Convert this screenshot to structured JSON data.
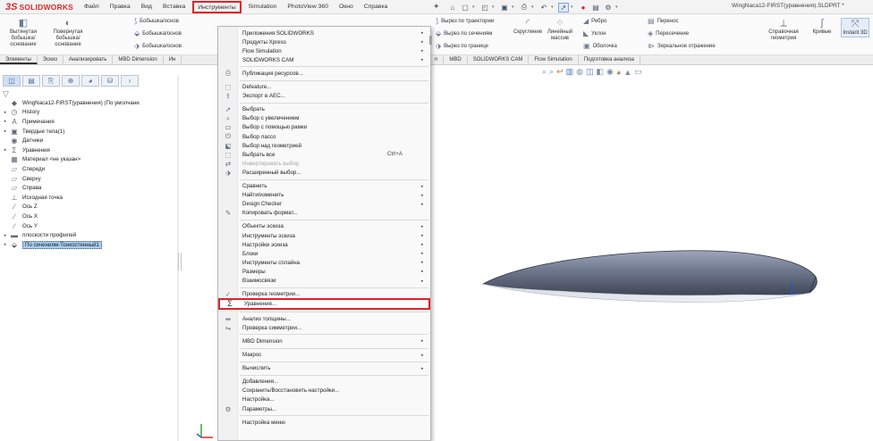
{
  "app": {
    "logo_ds": "3S",
    "logo_name": "SOLIDWORKS"
  },
  "menubar": [
    "Файл",
    "Правка",
    "Вид",
    "Вставка",
    "Инструменты",
    "Simulation",
    "PhotoView 360",
    "Окно",
    "Справка"
  ],
  "menubar_active": "Инструменты",
  "document_title": "WingNaca12-FIRST(уравнения).SLDPRT *",
  "quick_access_icons": [
    "home-icon",
    "new-icon",
    "open-icon",
    "save-icon",
    "print-icon",
    "undo-icon",
    "select-icon",
    "rebuild-icon",
    "options-icon"
  ],
  "ribbon": {
    "boss_extrude": "Вытянутая бобышка/основание",
    "boss_revolve": "Повернутая бобышка/основание",
    "boss_small": [
      "Бобышка/основ",
      "Бобышка/основ",
      "Бобышка/основ"
    ],
    "cut_small": [
      "Вырез по траектории",
      "Вырез по сечениям",
      "Вырез по границе"
    ],
    "cut_extrude": "Скругление",
    "linear_pattern": "Линейный массив",
    "features_col1": [
      "Ребро",
      "Уклон",
      "Оболочка"
    ],
    "features_col2": [
      "Перенос",
      "Пересечение",
      "Зеркальное отражение"
    ],
    "ref_geometry": "Справочная геометрия",
    "curves": "Кривые",
    "instant3d": "Instant 3D"
  },
  "command_tabs": [
    "Элементы",
    "Эскиз",
    "Анализировать",
    "MBD Dimension",
    "Ин"
  ],
  "command_tabs_right": [
    "n",
    "MBD",
    "SOLIDWORKS CAM",
    "Flow Simulation",
    "Подготовка анализа"
  ],
  "feature_tree": [
    {
      "label": "WingNaca12-FIRST(уравнения) (По умолчани",
      "icon": "part-icon",
      "arrow": ""
    },
    {
      "label": "History",
      "icon": "history-icon",
      "arrow": "▸"
    },
    {
      "label": "Примечания",
      "icon": "annotations-icon",
      "arrow": "▸"
    },
    {
      "label": "Твердые тела(1)",
      "icon": "solid-bodies-icon",
      "arrow": "▸"
    },
    {
      "label": "Датчики",
      "icon": "sensors-icon",
      "arrow": ""
    },
    {
      "label": "Уравнения",
      "icon": "equations-icon",
      "arrow": "▸"
    },
    {
      "label": "Материал <не указан>",
      "icon": "material-icon",
      "arrow": ""
    },
    {
      "label": "Спереди",
      "icon": "plane-icon",
      "arrow": ""
    },
    {
      "label": "Сверху",
      "icon": "plane-icon",
      "arrow": ""
    },
    {
      "label": "Справа",
      "icon": "plane-icon",
      "arrow": ""
    },
    {
      "label": "Исходная точка",
      "icon": "origin-icon",
      "arrow": ""
    },
    {
      "label": "Ось Z",
      "icon": "axis-icon",
      "arrow": ""
    },
    {
      "label": "Ось X",
      "icon": "axis-icon",
      "arrow": ""
    },
    {
      "label": "Ось Y",
      "icon": "axis-icon",
      "arrow": ""
    },
    {
      "label": "плоскости профилей",
      "icon": "folder-icon",
      "arrow": "▸"
    },
    {
      "label": "По сечениям-Тонкостенный1",
      "icon": "loft-icon",
      "arrow": "▸",
      "selected": true
    }
  ],
  "tools_menu": [
    {
      "label": "Приложения SOLIDWORKS",
      "submenu": true
    },
    {
      "label": "Продукты Xpress",
      "submenu": true
    },
    {
      "label": "Flow Simulation",
      "submenu": true
    },
    {
      "label": "SOLIDWORKS CAM",
      "submenu": true
    },
    {
      "sep": true
    },
    {
      "label": "Публикация ресурсов...",
      "icon": "publish-icon"
    },
    {
      "sep": true
    },
    {
      "label": "Defeature...",
      "icon": "defeature-icon"
    },
    {
      "label": "Экспорт в AEC...",
      "icon": "export-aec-icon"
    },
    {
      "sep": true
    },
    {
      "label": "Выбрать",
      "icon": "select-icon"
    },
    {
      "label": "Выбор с увеличением",
      "icon": "magnify-select-icon"
    },
    {
      "label": "Выбор с помощью рамки",
      "icon": "box-select-icon"
    },
    {
      "label": "Выбор лассо",
      "icon": "lasso-icon"
    },
    {
      "label": "Выбор над геометрией",
      "icon": "select-over-geometry-icon"
    },
    {
      "label": "Выбрать все",
      "icon": "select-all-icon",
      "shortcut": "Ctrl+A"
    },
    {
      "label": "Инвертировать выбор",
      "icon": "invert-selection-icon",
      "disabled": true
    },
    {
      "label": "Расширенный выбор...",
      "icon": "advanced-select-icon"
    },
    {
      "sep": true
    },
    {
      "label": "Сравнить",
      "submenu": true
    },
    {
      "label": "Найти/изменить",
      "submenu": true
    },
    {
      "label": "Design Checker",
      "submenu": true
    },
    {
      "label": "Копировать формат...",
      "icon": "format-painter-icon"
    },
    {
      "sep": true
    },
    {
      "label": "Объекты эскиза",
      "submenu": true
    },
    {
      "label": "Инструменты эскиза",
      "submenu": true
    },
    {
      "label": "Настройки эскиза",
      "submenu": true
    },
    {
      "label": "Блоки",
      "submenu": true
    },
    {
      "label": "Инструменты сплайна",
      "submenu": true
    },
    {
      "label": "Размеры",
      "submenu": true
    },
    {
      "label": "Взаимосвязи",
      "submenu": true
    },
    {
      "sep": true
    },
    {
      "label": "Проверка геометрии...",
      "icon": "check-icon"
    },
    {
      "label": "Уравнения...",
      "icon": "sigma-icon",
      "highlighted": true
    },
    {
      "sep": true
    },
    {
      "label": "Анализ толщины...",
      "icon": "thickness-icon"
    },
    {
      "label": "Проверка симметрии...",
      "icon": "symmetry-icon"
    },
    {
      "sep": true
    },
    {
      "label": "MBD Dimension",
      "submenu": true
    },
    {
      "sep": true
    },
    {
      "label": "Макрос",
      "submenu": true
    },
    {
      "sep": true
    },
    {
      "label": "Вычислить",
      "submenu": true
    },
    {
      "sep": true
    },
    {
      "label": "Добавления..."
    },
    {
      "label": "Сохранить/Восстановить настройки..."
    },
    {
      "label": "Настройка..."
    },
    {
      "label": "Параметры...",
      "icon": "gear-icon"
    },
    {
      "sep": true
    },
    {
      "label": "Настройка меню"
    }
  ],
  "colors": {
    "highlight": "#e0232a",
    "brand": "#d62b2b",
    "selection": "#a9cdf2",
    "wing_dark": "#3f4656",
    "wing_light": "#9ea6bb"
  }
}
